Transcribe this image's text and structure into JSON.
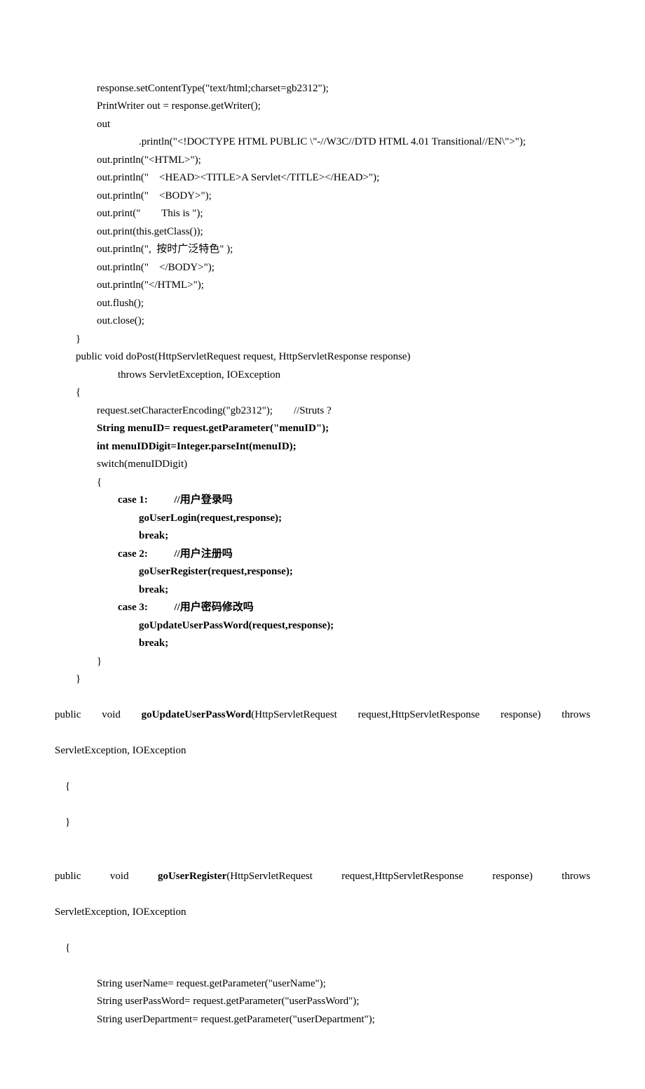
{
  "lines": [
    {
      "indent": 2,
      "bold": false,
      "text": "response.setContentType(\"text/html;charset=gb2312\");"
    },
    {
      "indent": 2,
      "bold": false,
      "text": "PrintWriter out = response.getWriter();"
    },
    {
      "indent": 2,
      "bold": false,
      "text": "out"
    },
    {
      "indent": 4,
      "bold": false,
      "text": ".println(\"<!DOCTYPE HTML PUBLIC \\\"-//W3C//DTD HTML 4.01 Transitional//EN\\\">\");"
    },
    {
      "indent": 2,
      "bold": false,
      "text": "out.println(\"<HTML>\");"
    },
    {
      "indent": 2,
      "bold": false,
      "text": "out.println(\"    <HEAD><TITLE>A Servlet</TITLE></HEAD>\");"
    },
    {
      "indent": 2,
      "bold": false,
      "text": "out.println(\"    <BODY>\");"
    },
    {
      "indent": 2,
      "bold": false,
      "text": "out.print(\"        This is \");"
    },
    {
      "indent": 2,
      "bold": false,
      "text": "out.print(this.getClass());"
    },
    {
      "indent": 2,
      "bold": false,
      "text": "out.println(\",  按时广泛特色\" );"
    },
    {
      "indent": 2,
      "bold": false,
      "text": "out.println(\"    </BODY>\");"
    },
    {
      "indent": 2,
      "bold": false,
      "text": "out.println(\"</HTML>\");"
    },
    {
      "indent": 2,
      "bold": false,
      "text": "out.flush();"
    },
    {
      "indent": 2,
      "bold": false,
      "text": "out.close();"
    },
    {
      "indent": 1,
      "bold": false,
      "text": "}"
    },
    {
      "indent": 1,
      "bold": false,
      "text": "public void doPost(HttpServletRequest request, HttpServletResponse response)"
    },
    {
      "indent": 3,
      "bold": false,
      "text": "throws ServletException, IOException"
    },
    {
      "indent": 1,
      "bold": false,
      "text": "{"
    },
    {
      "indent": 2,
      "bold": false,
      "text": "request.setCharacterEncoding(\"gb2312\");        //Struts ?"
    },
    {
      "indent": 2,
      "bold": true,
      "text": "String menuID= request.getParameter(\"menuID\");"
    },
    {
      "indent": 2,
      "bold": true,
      "text": "int menuIDDigit=Integer.parseInt(menuID);"
    },
    {
      "indent": 2,
      "bold": false,
      "text": "switch(menuIDDigit)"
    },
    {
      "indent": 2,
      "bold": false,
      "text": "{"
    },
    {
      "indent": 3,
      "bold": true,
      "text": "case 1:          //用户登录吗"
    },
    {
      "indent": 4,
      "bold": true,
      "text": "goUserLogin(request,response);"
    },
    {
      "indent": 4,
      "bold": true,
      "text": "break;"
    },
    {
      "indent": 3,
      "bold": true,
      "text": "case 2:          //用户注册吗"
    },
    {
      "indent": 4,
      "bold": true,
      "text": "goUserRegister(request,response);"
    },
    {
      "indent": 4,
      "bold": true,
      "text": "break;"
    },
    {
      "indent": 0,
      "bold": false,
      "text": ""
    },
    {
      "indent": 3,
      "bold": true,
      "text": "case 3:          //用户密码修改吗"
    },
    {
      "indent": 4,
      "bold": true,
      "text": "goUpdateUserPassWord(request,response);"
    },
    {
      "indent": 4,
      "bold": true,
      "text": "break;"
    },
    {
      "indent": 2,
      "bold": false,
      "text": "}"
    },
    {
      "indent": 1,
      "bold": false,
      "text": "}"
    }
  ],
  "para1_plain_before": "    public  void  ",
  "para1_bold": "goUpdateUserPassWord",
  "para1_plain_after": "(HttpServletRequest  request,HttpServletResponse  response)  throws",
  "para1_line2": "ServletException, IOException",
  "brace_open": "    {",
  "brace_close": "    }",
  "blank": "",
  "para2_plain_before": "    public     void     ",
  "para2_bold": "goUserRegister",
  "para2_plain_after": "(HttpServletRequest     request,HttpServletResponse     response)     throws",
  "para2_line2": "ServletException, IOException",
  "tail": [
    {
      "indent": 2,
      "text": "String userName= request.getParameter(\"userName\");"
    },
    {
      "indent": 2,
      "text": "String userPassWord= request.getParameter(\"userPassWord\");"
    },
    {
      "indent": 2,
      "text": "String userDepartment= request.getParameter(\"userDepartment\");"
    }
  ],
  "indent_unit": "        "
}
